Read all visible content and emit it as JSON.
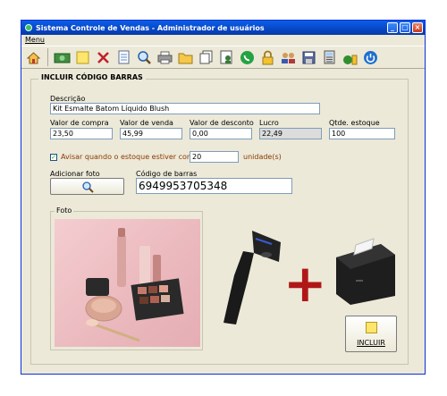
{
  "window": {
    "title": "Sistema Controle de Vendas - Administrador de usuários",
    "buttons": {
      "minimize": "_",
      "maximize": "□",
      "close": "×"
    }
  },
  "menu": {
    "label": "Menu"
  },
  "toolbar": {
    "icons": [
      "home-icon",
      "money-icon",
      "note-icon",
      "delete-icon",
      "document-icon",
      "search-icon",
      "printer-icon",
      "folder-icon",
      "copy-icon",
      "user-report-icon",
      "whatsapp-icon",
      "lock-icon",
      "users-icon",
      "save-icon",
      "calculator-icon",
      "money-bag-icon",
      "power-icon"
    ]
  },
  "form": {
    "section_title": "INCLUIR CÓDIGO BARRAS",
    "descricao": {
      "label": "Descrição",
      "value": "Kit Esmalte Batom Líquido Blush"
    },
    "valor_compra": {
      "label": "Valor de compra",
      "value": "23,50"
    },
    "valor_venda": {
      "label": "Valor de venda",
      "value": "45,99"
    },
    "valor_desconto": {
      "label": "Valor de desconto",
      "value": "0,00"
    },
    "lucro": {
      "label": "Lucro",
      "value": "22,49"
    },
    "qtde_estoque": {
      "label": "Qtde. estoque",
      "value": "100"
    },
    "aviso": {
      "label": "Avisar quando o estoque estiver com",
      "value": "20",
      "unit": "unidade(s)",
      "checked": true
    },
    "adicionar_foto": {
      "label": "Adicionar foto"
    },
    "codigo_barras": {
      "label": "Código de barras",
      "value": "6949953705348"
    },
    "foto": {
      "legend": "Foto"
    },
    "plus_sign": "+",
    "incluir_button": {
      "label": "INCLUIR"
    }
  },
  "colors": {
    "title_blue": "#0a5fe8",
    "window_bg": "#ece9d8",
    "plus_red": "#b01818",
    "photo_pink": "#eab8bd"
  }
}
